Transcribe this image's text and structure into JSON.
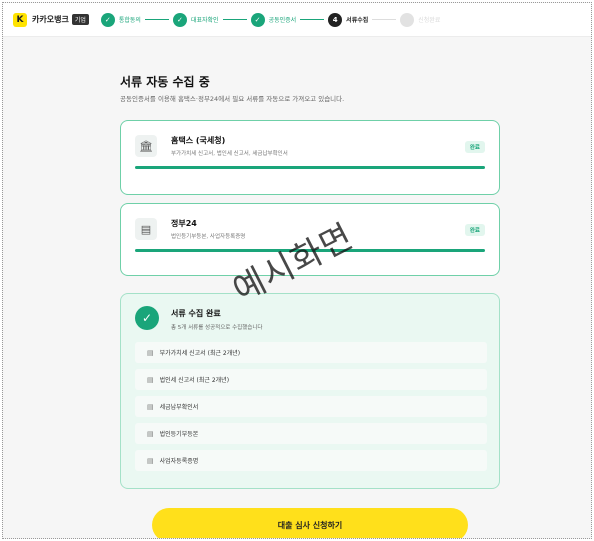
{
  "header": {
    "logo_letter": "K",
    "brand": "카카오뱅크",
    "brand_badge": "기업",
    "steps": [
      {
        "num": "✓",
        "label": "통합동의",
        "state": "done"
      },
      {
        "num": "✓",
        "label": "대표자확인",
        "state": "done"
      },
      {
        "num": "✓",
        "label": "공동인증서",
        "state": "done"
      },
      {
        "num": "4",
        "label": "서류수집",
        "state": "current"
      },
      {
        "num": "5",
        "label": "신청완료",
        "state": "pending"
      }
    ]
  },
  "main": {
    "title": "서류 자동 수집 중",
    "subtitle": "공동인증서를 이용해 홈택스·정부24에서 필요 서류를 자동으로 가져오고 있습니다.",
    "sources": [
      {
        "icon": "🏛",
        "name": "홈택스 (국세청)",
        "desc": "부가가치세 신고서, 법인세 신고서, 세금납부확인서",
        "status": "완료",
        "progress": 1.0
      },
      {
        "icon": "▤",
        "name": "정부24",
        "desc": "법인등기부등본, 사업자등록증명",
        "status": "완료",
        "progress": 1.0
      }
    ],
    "complete": {
      "title": "서류 수집 완료",
      "desc": "총 5개 서류를 성공적으로 수집했습니다",
      "docs": [
        "부가가치세 신고서 (최근 2개년)",
        "법인세 신고서 (최근 2개년)",
        "세금납부확인서",
        "법인등기부등본",
        "사업자등록증명"
      ]
    },
    "submit_label": "대출 심사 신청하기"
  },
  "watermark": "예시화면",
  "colors": {
    "accent": "#1aa57a",
    "button": "#ffe01b",
    "brand": "#ffe300"
  }
}
